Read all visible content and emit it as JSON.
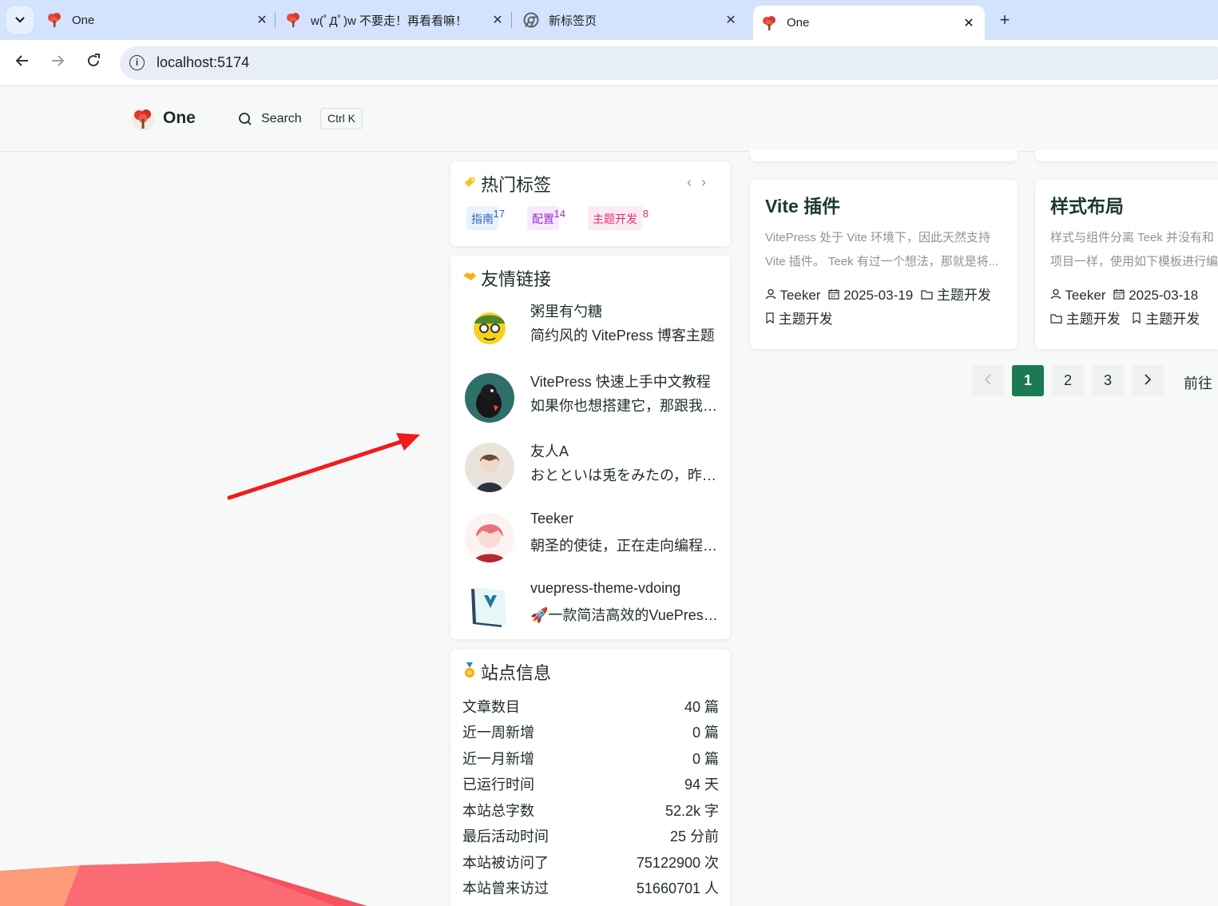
{
  "browser": {
    "tabs": [
      {
        "title": "One"
      },
      {
        "title": "w(ﾟДﾟ)w 不要走！再看看嘛！"
      },
      {
        "title": "新标签页"
      },
      {
        "title": "One"
      }
    ],
    "close_glyph": "✕",
    "new_tab_glyph": "+",
    "url": "localhost:5174"
  },
  "site": {
    "title": "One",
    "search_label": "Search",
    "search_shortcut": "Ctrl K"
  },
  "hot_tags": {
    "title": "热门标签",
    "tags": [
      {
        "label": "指南",
        "count": "17",
        "color": "#2f63c9",
        "bg": "#eaf1fe"
      },
      {
        "label": "配置",
        "count": "14",
        "color": "#9b2fc9",
        "bg": "#f6eafe"
      },
      {
        "label": "主题开发",
        "count": "8",
        "color": "#e0307a",
        "bg": "#fdeaf2"
      }
    ]
  },
  "friend_links": {
    "title": "友情链接",
    "items": [
      {
        "name": "粥里有勺糖",
        "desc": "简约风的 VitePress 博客主题"
      },
      {
        "name": "VitePress 快速上手中文教程",
        "desc": "如果你也想搭建它，那跟我一起做吧"
      },
      {
        "name": "友人A",
        "desc": "おとといは兎をみたの，昨日は鹿"
      },
      {
        "name": "Teeker",
        "desc": "朝圣的使徒，正在走向编程的至高殿堂"
      },
      {
        "name": "vuepress-theme-vdoing",
        "desc": "🚀一款简洁高效的VuePress知识管理"
      }
    ]
  },
  "site_info": {
    "title": "站点信息",
    "rows": [
      {
        "label": "文章数目",
        "value": "40 篇"
      },
      {
        "label": "近一周新增",
        "value": "0 篇"
      },
      {
        "label": "近一月新增",
        "value": "0 篇"
      },
      {
        "label": "已运行时间",
        "value": "94 天"
      },
      {
        "label": "本站总字数",
        "value": "52.2k 字"
      },
      {
        "label": "最后活动时间",
        "value": "25 分前"
      },
      {
        "label": "本站被访问了",
        "value": "75122900 次"
      },
      {
        "label": "本站曾来访过",
        "value": "51660701 人"
      }
    ]
  },
  "posts": [
    {
      "title": "Vite 插件",
      "desc_line1": "VitePress 处于 Vite 环境下，因此天然支持",
      "desc_line2": "Vite 插件。 Teek 有过一个想法，那就是将...",
      "author": "Teeker",
      "date": "2025-03-19",
      "category": "主题开发",
      "tag": "主题开发"
    },
    {
      "title": "样式布局",
      "desc_line1": "样式与组件分离 Teek 并没有和",
      "desc_line2": "项目一样，使用如下模板进行编",
      "author": "Teeker",
      "date": "2025-03-18",
      "category": "主题开发",
      "tag": "主题开发"
    }
  ],
  "pagination": {
    "pages": [
      "1",
      "2",
      "3"
    ],
    "current": "1",
    "goto_label": "前往"
  }
}
